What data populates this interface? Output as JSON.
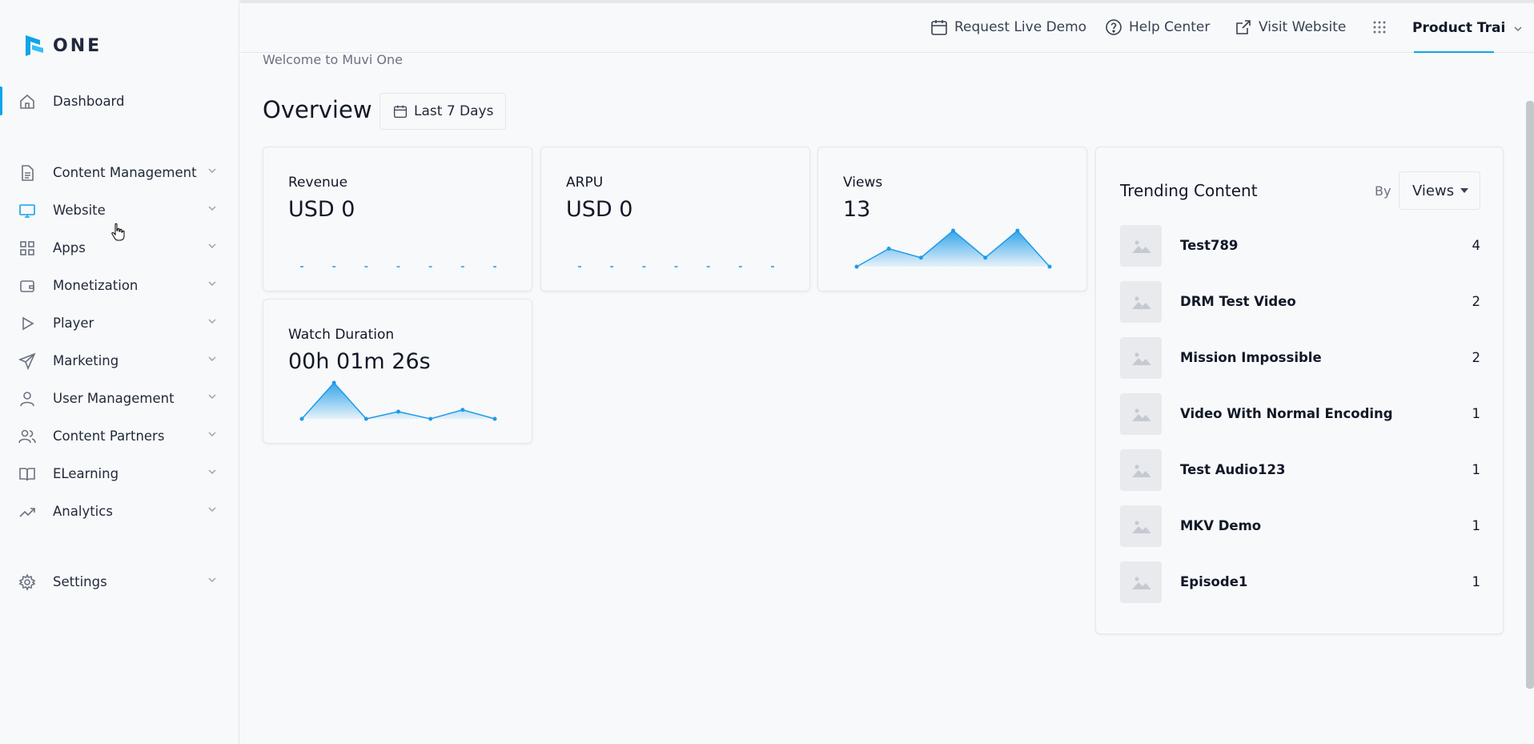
{
  "brand": {
    "logo_text": "ONE"
  },
  "header": {
    "request_demo": "Request Live Demo",
    "help_center": "Help Center",
    "visit_website": "Visit Website",
    "product_menu": "Product Trai"
  },
  "sidebar": {
    "dashboard": "Dashboard",
    "items": [
      {
        "label": "Content Management",
        "icon": "document-icon"
      },
      {
        "label": "Website",
        "icon": "monitor-icon"
      },
      {
        "label": "Apps",
        "icon": "grid-icon"
      },
      {
        "label": "Monetization",
        "icon": "wallet-icon"
      },
      {
        "label": "Player",
        "icon": "play-icon"
      },
      {
        "label": "Marketing",
        "icon": "send-icon"
      },
      {
        "label": "User Management",
        "icon": "user-icon"
      },
      {
        "label": "Content Partners",
        "icon": "users-icon"
      },
      {
        "label": "ELearning",
        "icon": "book-icon"
      },
      {
        "label": "Analytics",
        "icon": "trending-up-icon"
      }
    ],
    "settings": "Settings"
  },
  "main": {
    "welcome": "Welcome to Muvi One",
    "overview_title": "Overview",
    "date_range": "Last 7 Days"
  },
  "metrics": {
    "revenue": {
      "label": "Revenue",
      "value": "USD 0"
    },
    "arpu": {
      "label": "ARPU",
      "value": "USD 0"
    },
    "views": {
      "label": "Views",
      "value": "13"
    },
    "watch_duration": {
      "label": "Watch Duration",
      "value": "00h 01m 26s"
    }
  },
  "trending": {
    "title": "Trending Content",
    "by_label": "By",
    "sort_value": "Views",
    "items": [
      {
        "title": "Test789",
        "count": "4"
      },
      {
        "title": "DRM Test Video",
        "count": "2"
      },
      {
        "title": "Mission Impossible",
        "count": "2"
      },
      {
        "title": "Video With Normal Encoding",
        "count": "1"
      },
      {
        "title": "Test Audio123",
        "count": "1"
      },
      {
        "title": "MKV Demo",
        "count": "1"
      },
      {
        "title": "Episode1",
        "count": "1"
      }
    ]
  },
  "sparklines": {
    "revenue": [
      0,
      0,
      0,
      0,
      0,
      0,
      0
    ],
    "arpu": [
      0,
      0,
      0,
      0,
      0,
      0,
      0
    ],
    "views": [
      0,
      1,
      0.5,
      2,
      0.5,
      2,
      0
    ],
    "watch_duration": [
      0,
      40,
      0,
      8,
      0,
      10,
      0
    ]
  },
  "colors": {
    "accent": "#0ea5e9",
    "spark": "#1e9be8"
  }
}
